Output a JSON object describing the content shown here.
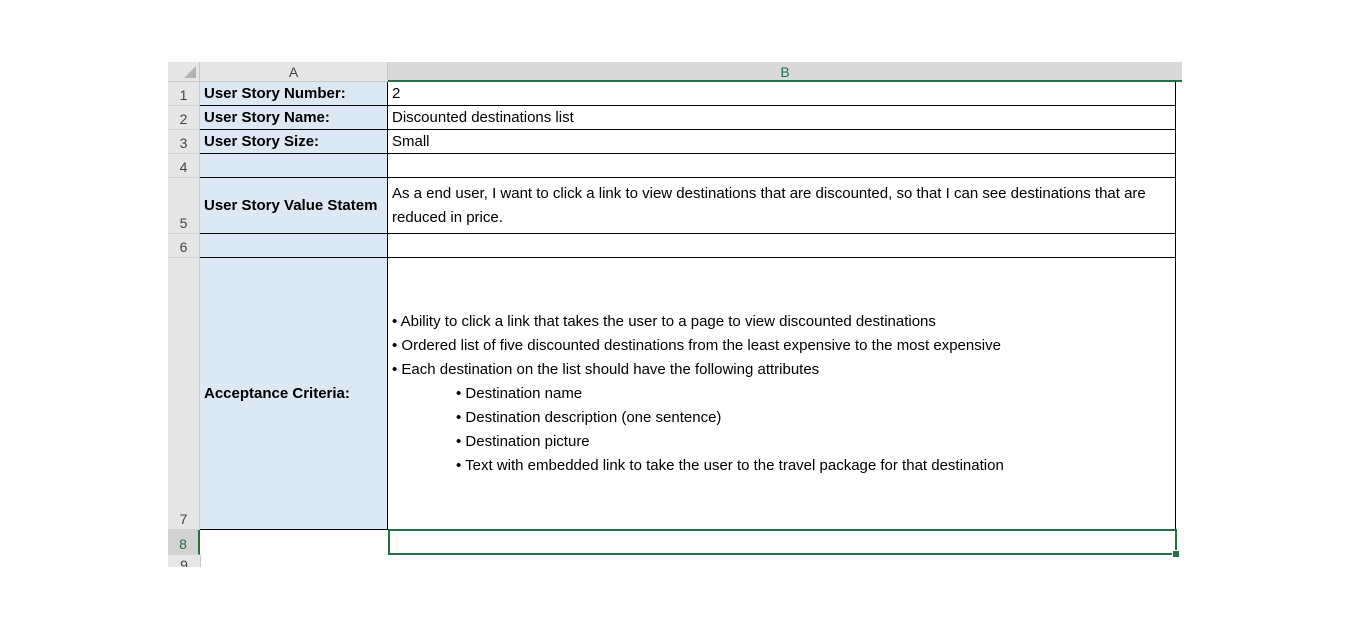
{
  "columns": {
    "a": "A",
    "b": "B"
  },
  "row_numbers": [
    "1",
    "2",
    "3",
    "4",
    "5",
    "6",
    "7",
    "8",
    "9"
  ],
  "rows": {
    "r1": {
      "label": "User Story Number:",
      "value": "2"
    },
    "r2": {
      "label": "User Story Name:",
      "value": "Discounted destinations list"
    },
    "r3": {
      "label": "User Story Size:",
      "value": "Small"
    },
    "r5": {
      "label": "User Story Value Statem",
      "value": "As a end user, I want to click a link to view destinations that are discounted, so that I can see destinations that are reduced in price."
    },
    "r7": {
      "label": "Acceptance Criteria:",
      "items": [
        "• Ability to click a link that takes the user to a page to view discounted destinations",
        "• Ordered list of five discounted destinations from the least expensive to the most expensive",
        "• Each destination on the list should have the following attributes"
      ],
      "subitems": [
        "• Destination name",
        "• Destination description (one sentence)",
        "• Destination picture",
        "• Text with embedded link to take the user to the travel package for that destination"
      ]
    }
  },
  "colors": {
    "accent": "#217346",
    "label_fill": "#dde8f5"
  }
}
